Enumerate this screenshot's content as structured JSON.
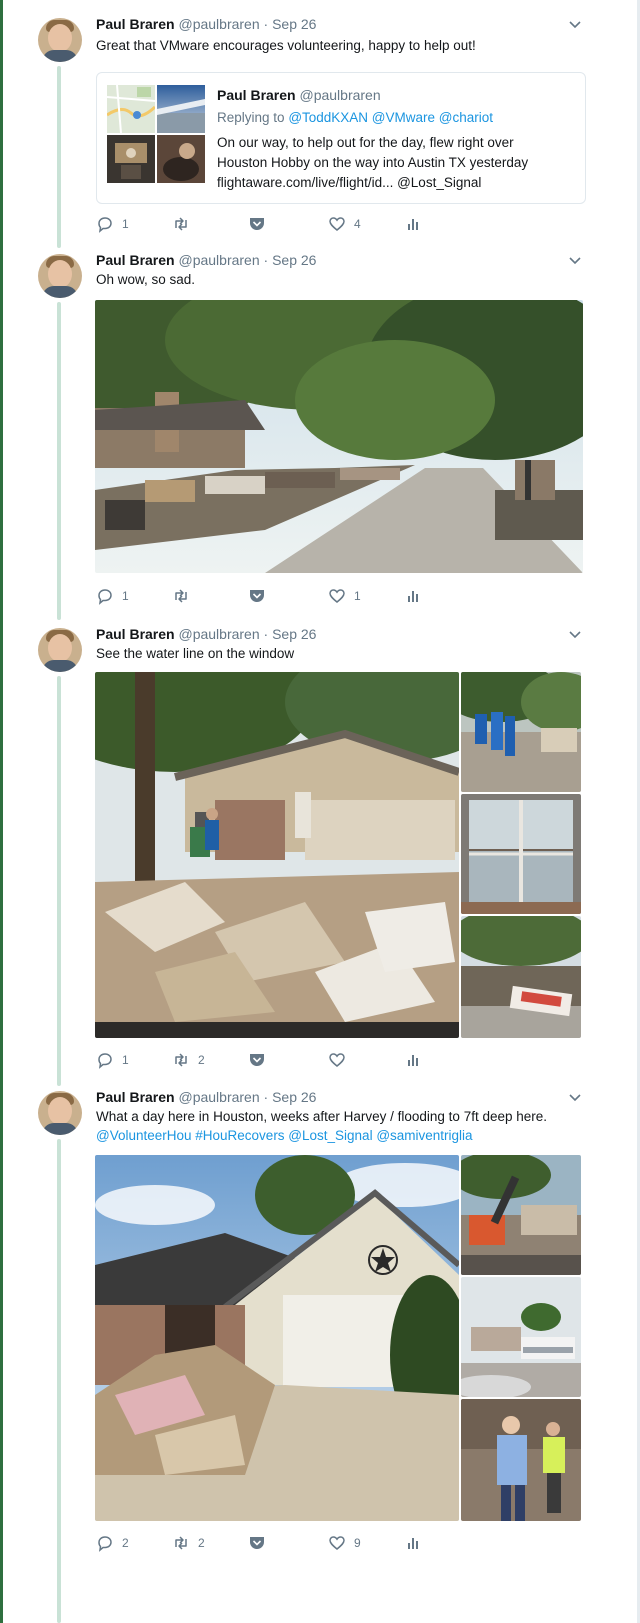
{
  "tweets": [
    {
      "author": {
        "name": "Paul Braren",
        "handle": "@paulbraren"
      },
      "separator": "·",
      "date": "Sep 26",
      "text": "Great that VMware encourages volunteering, happy to help out!",
      "quoted": {
        "author": {
          "name": "Paul Braren",
          "handle": "@paulbraren"
        },
        "reply_prefix": "Replying to",
        "reply_to": "@ToddKXAN @VMware @chariot",
        "text_line1": "On our way, to help out for the day, flew right over",
        "text_line2": "Houston Hobby on the way into Austin TX yesterday",
        "link": "flightaware.com/live/flight/id...",
        "mention": "@Lost_Signal"
      },
      "replies": "1",
      "retweets": "",
      "likes": "4"
    },
    {
      "author": {
        "name": "Paul Braren",
        "handle": "@paulbraren"
      },
      "separator": "·",
      "date": "Sep 26",
      "text": "Oh wow, so sad.",
      "replies": "1",
      "retweets": "",
      "likes": "1"
    },
    {
      "author": {
        "name": "Paul Braren",
        "handle": "@paulbraren"
      },
      "separator": "·",
      "date": "Sep 26",
      "text": "See the water line on the window",
      "replies": "1",
      "retweets": "2",
      "likes": ""
    },
    {
      "author": {
        "name": "Paul Braren",
        "handle": "@paulbraren"
      },
      "separator": "·",
      "date": "Sep 26",
      "text": "What a day here in Houston, weeks after Harvey / flooding to 7ft deep here.",
      "mentions": "@VolunteerHou #HouRecovers @Lost_Signal @samiventriglia",
      "replies": "2",
      "retweets": "2",
      "likes": "9"
    }
  ],
  "icons": {
    "reply": "reply-icon",
    "retweet": "retweet-icon",
    "save": "pocket-icon",
    "like": "heart-icon",
    "analytics": "analytics-icon",
    "menu": "chevron-down-icon"
  },
  "colors": {
    "text": "#14171a",
    "muted": "#657786",
    "link": "#1b95e0",
    "thread": "#c9e2d6",
    "border": "#e1e8ed"
  }
}
